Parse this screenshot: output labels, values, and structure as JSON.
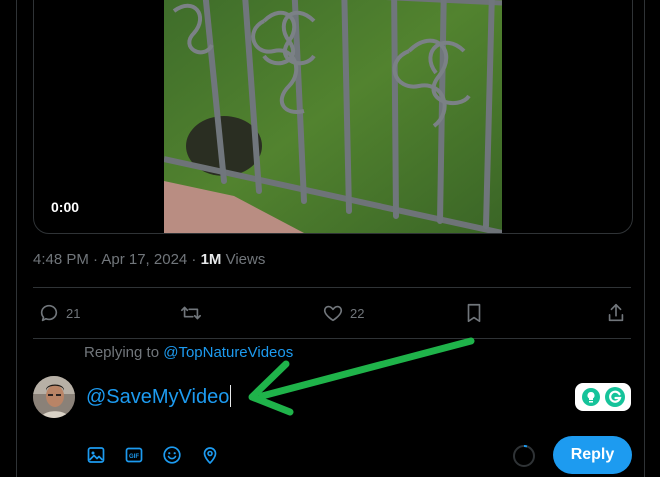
{
  "video": {
    "elapsed": "0:00"
  },
  "tweet_meta": {
    "time_date": "4:48 PM · Apr 17, 2024 · ",
    "views_count": "1M",
    "views_label": " Views"
  },
  "actions": {
    "reply_count": "21",
    "like_count": "22"
  },
  "reply": {
    "replying_prefix": "Replying to ",
    "replying_handle": "@TopNatureVideos",
    "text": "@SaveMyVideo",
    "button_label": "Reply"
  },
  "icons": {
    "reply": "comment-bubble-icon",
    "retweet": "retweet-icon",
    "like": "heart-icon",
    "bookmark": "bookmark-icon",
    "share": "share-upload-icon",
    "media": "image-icon",
    "gif": "gif-icon",
    "emoji": "emoji-icon",
    "location": "location-pin-icon"
  },
  "colors": {
    "accent": "#1d9bf0",
    "muted": "#71767b",
    "border": "#2f3336",
    "annotation_arrow": "#1fb34a"
  }
}
